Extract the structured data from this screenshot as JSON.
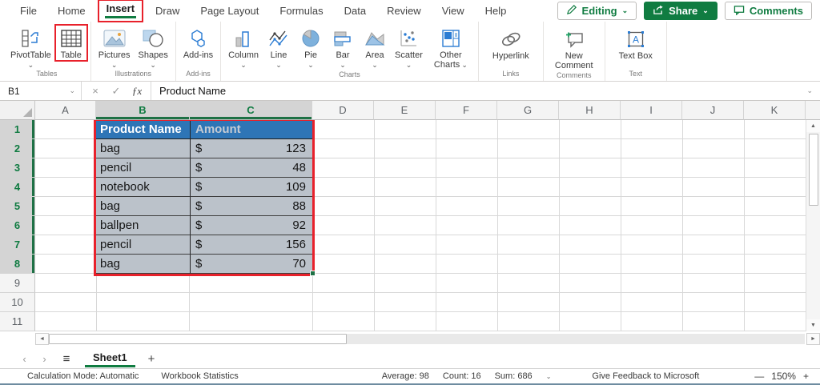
{
  "menubar": {
    "tabs": [
      "File",
      "Home",
      "Insert",
      "Draw",
      "Page Layout",
      "Formulas",
      "Data",
      "Review",
      "View",
      "Help"
    ],
    "active_tab": "Insert",
    "editing": {
      "label": "Editing"
    },
    "share": {
      "label": "Share"
    },
    "comments": {
      "label": "Comments"
    }
  },
  "ribbon": {
    "groups": [
      {
        "label": "Tables",
        "items": [
          {
            "label": "PivotTable",
            "icon": "pivottable-icon"
          },
          {
            "label": "Table",
            "icon": "table-icon",
            "highlighted": true
          }
        ]
      },
      {
        "label": "Illustrations",
        "items": [
          {
            "label": "Pictures",
            "icon": "pictures-icon"
          },
          {
            "label": "Shapes",
            "icon": "shapes-icon"
          }
        ]
      },
      {
        "label": "Add-ins",
        "items": [
          {
            "label": "Add-ins",
            "icon": "addins-icon"
          }
        ]
      },
      {
        "label": "Charts",
        "items": [
          {
            "label": "Column",
            "icon": "column-chart-icon"
          },
          {
            "label": "Line",
            "icon": "line-chart-icon"
          },
          {
            "label": "Pie",
            "icon": "pie-chart-icon"
          },
          {
            "label": "Bar",
            "icon": "bar-chart-icon"
          },
          {
            "label": "Area",
            "icon": "area-chart-icon"
          },
          {
            "label": "Scatter",
            "icon": "scatter-chart-icon"
          },
          {
            "label": "Other Charts",
            "icon": "other-charts-icon"
          }
        ]
      },
      {
        "label": "Links",
        "items": [
          {
            "label": "Hyperlink",
            "icon": "hyperlink-icon"
          }
        ]
      },
      {
        "label": "Comments",
        "items": [
          {
            "label": "New Comment",
            "icon": "new-comment-icon"
          }
        ]
      },
      {
        "label": "Text",
        "items": [
          {
            "label": "Text Box",
            "icon": "textbox-icon"
          }
        ]
      }
    ]
  },
  "formula_bar": {
    "name_box": "B1",
    "formula": "Product Name"
  },
  "sheet": {
    "columns": [
      "A",
      "B",
      "C",
      "D",
      "E",
      "F",
      "G",
      "H",
      "I",
      "J",
      "K"
    ],
    "rows": [
      "1",
      "2",
      "3",
      "4",
      "5",
      "6",
      "7",
      "8",
      "9",
      "10",
      "11"
    ],
    "selected_columns": [
      "B",
      "C"
    ],
    "selected_rows": [
      "1",
      "2",
      "3",
      "4",
      "5",
      "6",
      "7",
      "8"
    ],
    "table": {
      "currency": "$",
      "headers": [
        "Product Name",
        "Amount"
      ],
      "rows": [
        {
          "product": "bag",
          "amount": "123"
        },
        {
          "product": "pencil",
          "amount": "48"
        },
        {
          "product": "notebook",
          "amount": "109"
        },
        {
          "product": "bag",
          "amount": "88"
        },
        {
          "product": "ballpen",
          "amount": "92"
        },
        {
          "product": "pencil",
          "amount": "156"
        },
        {
          "product": "bag",
          "amount": "70"
        }
      ]
    }
  },
  "sheet_tabs": {
    "sheet_name": "Sheet1"
  },
  "status_bar": {
    "calculation_mode": "Calculation Mode: Automatic",
    "workbook_statistics": "Workbook Statistics",
    "average": "Average: 98",
    "count": "Count: 16",
    "sum": "Sum: 686",
    "feedback": "Give Feedback to Microsoft",
    "zoom_out": "—",
    "zoom_level": "150%",
    "zoom_in": "+"
  },
  "colors": {
    "excel_green": "#107C41",
    "highlight_red": "#E8212B",
    "table_header_blue": "#2E75B6",
    "selected_cell_fill": "#BBC2CA",
    "selected_header_fill": "#D4D4D4"
  }
}
